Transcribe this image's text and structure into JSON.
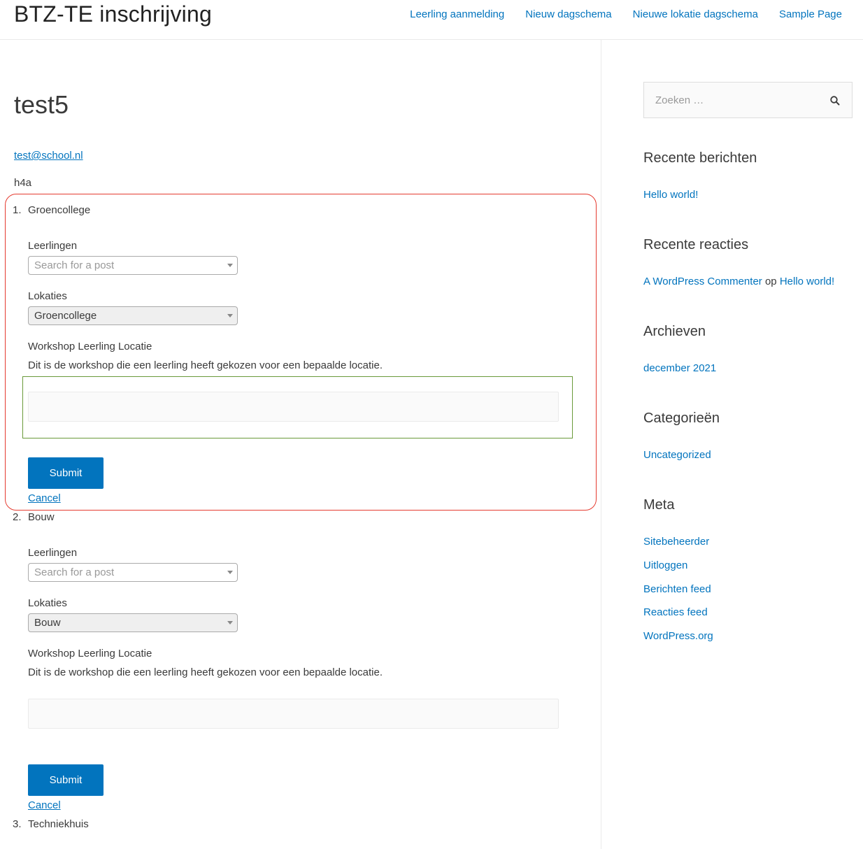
{
  "header": {
    "site_title": "BTZ-TE inschrijving",
    "nav": [
      "Leerling aanmelding",
      "Nieuw dagschema",
      "Nieuwe lokatie dagschema",
      "Sample Page"
    ]
  },
  "main": {
    "title": "test5",
    "email": "test@school.nl",
    "subtitle": "h4a",
    "items": [
      {
        "num": "1.",
        "name": "Groencollege",
        "leerlingen_label": "Leerlingen",
        "leerlingen_placeholder": "Search for a post",
        "lokaties_label": "Lokaties",
        "lokaties_value": "Groencollege",
        "workshop_label": "Workshop Leerling Locatie",
        "workshop_desc": "Dit is de workshop die een leerling heeft gekozen voor een bepaalde locatie.",
        "submit": "Submit",
        "cancel": "Cancel"
      },
      {
        "num": "2.",
        "name": "Bouw",
        "leerlingen_label": "Leerlingen",
        "leerlingen_placeholder": "Search for a post",
        "lokaties_label": "Lokaties",
        "lokaties_value": "Bouw",
        "workshop_label": "Workshop Leerling Locatie",
        "workshop_desc": "Dit is de workshop die een leerling heeft gekozen voor een bepaalde locatie.",
        "submit": "Submit",
        "cancel": "Cancel"
      },
      {
        "num": "3.",
        "name": "Techniekhuis"
      }
    ]
  },
  "sidebar": {
    "search_placeholder": "Zoeken …",
    "recent_posts_title": "Recente berichten",
    "recent_posts": [
      "Hello world!"
    ],
    "recent_comments_title": "Recente reacties",
    "recent_comment": {
      "author": "A WordPress Commenter",
      "joiner": "op",
      "post": "Hello world!"
    },
    "archives_title": "Archieven",
    "archives": [
      "december 2021"
    ],
    "categories_title": "Categorieën",
    "categories": [
      "Uncategorized"
    ],
    "meta_title": "Meta",
    "meta": [
      "Sitebeheerder",
      "Uitloggen",
      "Berichten feed",
      "Reacties feed",
      "WordPress.org"
    ]
  },
  "colors": {
    "accent": "#0274be",
    "highlight_red": "#e53b30",
    "highlight_green": "#6a9a3a"
  }
}
